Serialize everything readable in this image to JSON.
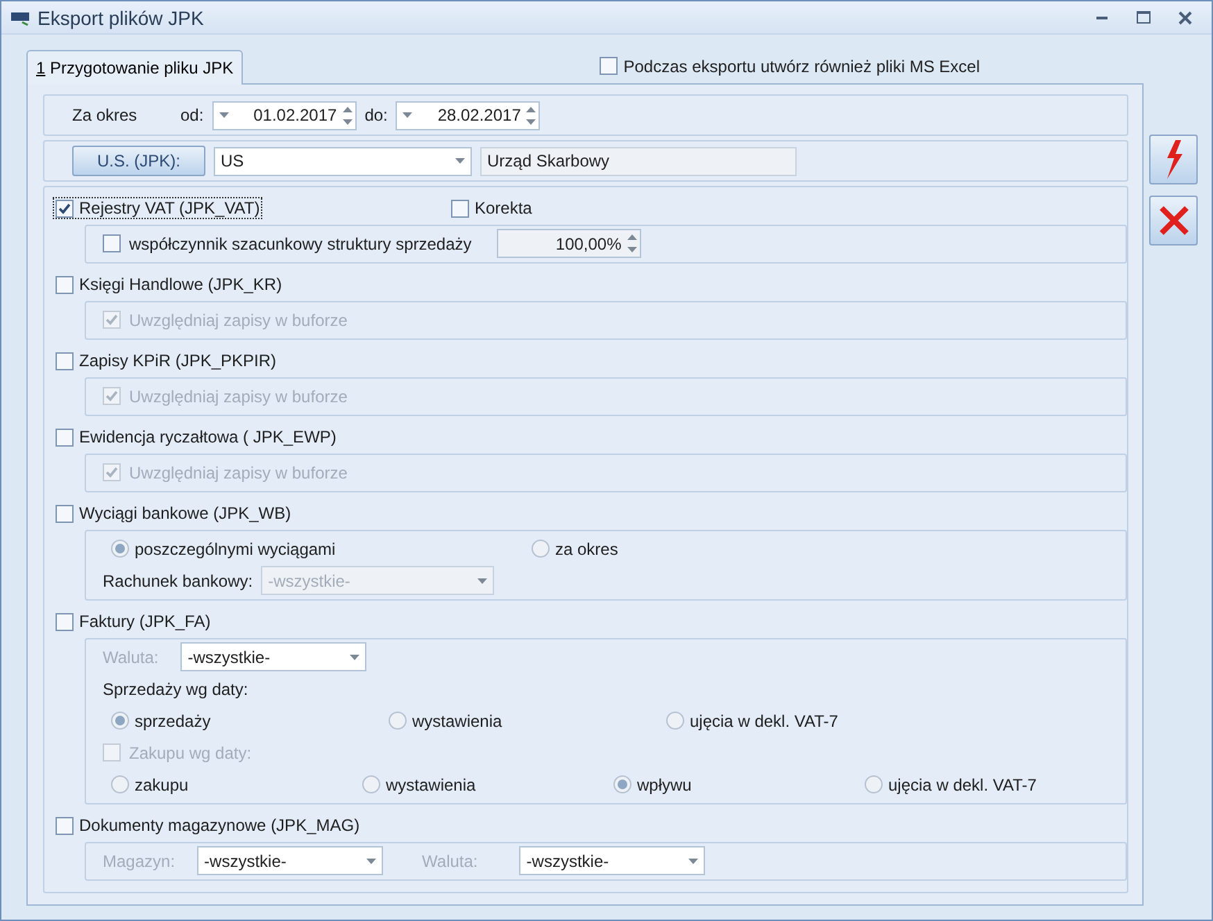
{
  "window": {
    "title": "Eksport plików JPK"
  },
  "tabs": [
    {
      "mnemonic": "1",
      "label": "Przygotowanie pliku JPK",
      "selected": true
    }
  ],
  "excel_option": {
    "label": "Podczas eksportu utwórz również pliki MS Excel",
    "checked": false
  },
  "period": {
    "label": "Za okres",
    "from_label": "od:",
    "from": "01.02.2017",
    "to_label": "do:",
    "to": "28.02.2017"
  },
  "tax_office": {
    "button": "U.S. (JPK):",
    "code": "US",
    "name": "Urząd Skarbowy"
  },
  "sections": [
    {
      "label": "Rejestry VAT (JPK_VAT)",
      "checked": true,
      "focused": true,
      "extra": {
        "label": "Korekta",
        "checked": false
      },
      "body": [
        {
          "kind": "check_spin",
          "label": "współczynnik szacunkowy struktury sprzedaży",
          "checked": false,
          "value": "100,00%"
        }
      ]
    },
    {
      "label": "Księgi Handlowe (JPK_KR)",
      "checked": false,
      "focused": false,
      "body": [
        {
          "kind": "check",
          "label": "Uwzględniaj zapisy w buforze",
          "checked": true,
          "disabled": true
        }
      ]
    },
    {
      "label": "Zapisy KPiR (JPK_PKPIR)",
      "checked": false,
      "focused": false,
      "body": [
        {
          "kind": "check",
          "label": "Uwzględniaj zapisy w buforze",
          "checked": true,
          "disabled": true
        }
      ]
    },
    {
      "label": "Ewidencja ryczałtowa ( JPK_EWP)",
      "checked": false,
      "focused": false,
      "body": [
        {
          "kind": "check",
          "label": "Uwzględniaj zapisy w buforze",
          "checked": true,
          "disabled": true
        }
      ]
    },
    {
      "label": "Wyciągi bankowe (JPK_WB)",
      "checked": false,
      "focused": false,
      "body": [
        {
          "kind": "radios",
          "options": [
            {
              "label": "poszczególnymi wyciągami",
              "selected": true
            },
            {
              "label": "za okres",
              "selected": false
            }
          ]
        },
        {
          "kind": "selects",
          "fields": [
            {
              "label": "Rachunek bankowy:",
              "label_disabled": false,
              "value": "-wszystkie-",
              "disabled": true
            }
          ]
        }
      ]
    },
    {
      "label": "Faktury (JPK_FA)",
      "checked": false,
      "focused": false,
      "body": [
        {
          "kind": "selects",
          "fields": [
            {
              "label": "Waluta:",
              "label_disabled": true,
              "value": "-wszystkie-",
              "disabled": false
            }
          ]
        },
        {
          "kind": "caption",
          "label": "Sprzedaży wg daty:"
        },
        {
          "kind": "radios",
          "options": [
            {
              "label": "sprzedaży",
              "selected": true
            },
            {
              "label": "wystawienia",
              "selected": false
            },
            {
              "label": "ujęcia w dekl. VAT-7",
              "selected": false
            }
          ]
        },
        {
          "kind": "check",
          "label": "Zakupu wg daty:",
          "checked": false,
          "disabled": true
        },
        {
          "kind": "radios",
          "options": [
            {
              "label": "zakupu",
              "selected": false
            },
            {
              "label": "wystawienia",
              "selected": false
            },
            {
              "label": "wpływu",
              "selected": true
            },
            {
              "label": "ujęcia w dekl. VAT-7",
              "selected": false
            }
          ]
        }
      ]
    },
    {
      "label": "Dokumenty magazynowe (JPK_MAG)",
      "checked": false,
      "focused": false,
      "body": [
        {
          "kind": "selects",
          "fields": [
            {
              "label": "Magazyn:",
              "label_disabled": true,
              "value": "-wszystkie-",
              "disabled": false
            },
            {
              "label": "Waluta:",
              "label_disabled": true,
              "value": "-wszystkie-",
              "disabled": false
            }
          ]
        }
      ]
    }
  ]
}
